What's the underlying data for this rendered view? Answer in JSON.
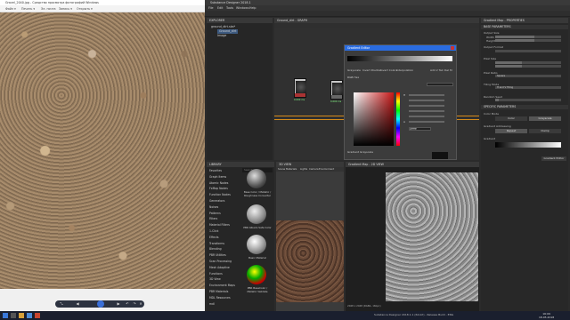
{
  "viewer": {
    "title": "Gravel_2040.jpg - Средство просмотра фотографий Windows",
    "menu": [
      "Файл ▾",
      "Печать ▾",
      "Эл. почта",
      "Запись ▾",
      "Открыть ▾"
    ],
    "controls": [
      "⤡",
      "◀",
      "▶",
      "↶",
      "↷",
      "✕"
    ]
  },
  "designer": {
    "title": "Substance Designer 2018.1",
    "menu": [
      "File",
      "Edit",
      "Tools",
      "Windows",
      "Help"
    ],
    "explorer": {
      "header": "EXPLORER",
      "tree": [
        "ground_dirt.sbs*",
        "Ground_dirt",
        "Image"
      ]
    },
    "graph": {
      "tab": "Ground_dirt - GRAPH",
      "node1_label": "0.000 ms",
      "node2_label": "0.000 ms"
    },
    "gradient_editor": {
      "title": "Gradient Editor",
      "options": [
        "Grayscale",
        "Invert Position",
        "Invert Colors",
        "Interpolation"
      ],
      "add_label": "Add 2 Tail",
      "del_label": "Del M",
      "rgb_label": "RGB Hex",
      "hex": "#ffffff",
      "hue_label": "H",
      "alpha_label": "A",
      "greyscale_label": "Gradient Grayscale"
    },
    "library": {
      "header": "LIBRARY",
      "search_placeholder": "Search",
      "items": [
        "Favorites",
        "Graph Items",
        "Atomic Nodes",
        "FxMap Nodes",
        "Function Nodes",
        "Generators",
        "Noises",
        "Patterns",
        "Filters",
        "Material Filters",
        "1-Click",
        "Effects",
        "Transforms",
        "Blending",
        "PBR Utilities",
        "Scan Processing",
        "Mesh Adaptive",
        "Functions",
        "3D View",
        "Environment Maps",
        "PBR Materials",
        "MDL Resources",
        "mdl"
      ],
      "thumbs": [
        {
          "caption": "Base Color / Metallic / Roughness Converter"
        },
        {
          "caption": "PBR Albedo Safe Color"
        },
        {
          "caption": "Basic Material"
        },
        {
          "caption": "PBR BaseColor / Metallic Validate"
        }
      ]
    },
    "view3d": {
      "header": "3D VIEW",
      "menu": [
        "Scene",
        "Materials",
        "Lights",
        "Camera",
        "Environment"
      ]
    },
    "view2d": {
      "header": "Gradient Map - 2D VIEW",
      "status": "2048 x 2048 (RGBA, 16bpc)"
    },
    "properties": {
      "header": "Gradient Map - PROPERTIES",
      "sections": [
        "BASE PARAMETERS",
        "SPECIFIC PARAMETERS"
      ],
      "labels": [
        "Output Size",
        "Width",
        "Height",
        "Output Format",
        "Pixel Size",
        "Pixel Ratio",
        "Tiling Mode",
        "Random Seed",
        "Color Mode",
        "Gradient Addressing",
        "Gradient"
      ],
      "buttons": [
        "Color",
        "Grayscale",
        "Repeat",
        "Clamp",
        "Gradient Editor"
      ],
      "pixel_ratio_value": "Square",
      "tiling_value": "H and V Tiling"
    }
  },
  "taskbar": {
    "time": "16:09",
    "date": "18.05.2018",
    "status_text": "Substance Designer 2018.1.1 (64-bit) - Release Build - ENG"
  }
}
